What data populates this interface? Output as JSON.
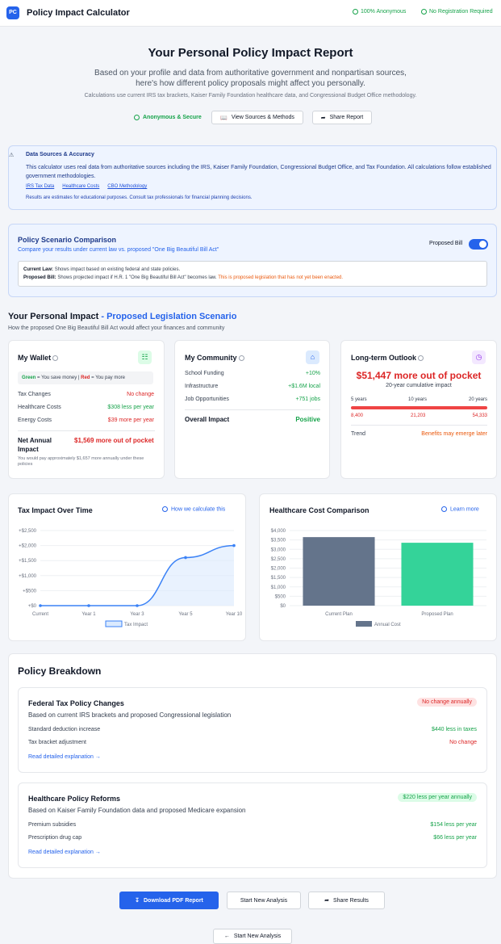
{
  "app": {
    "logo": "PC",
    "title": "Policy Impact Calculator",
    "badge_anonymous": "100% Anonymous",
    "badge_noreg": "No Registration Required"
  },
  "hero": {
    "title": "Your Personal Policy Impact Report",
    "subtitle": "Based on your profile and data from authoritative government and nonpartisan sources, here's how different policy proposals might affect you personally.",
    "note": "Calculations use current IRS tax brackets, Kaiser Family Foundation healthcare data, and Congressional Budget Office methodology.",
    "anon_label": "Anonymous & Secure",
    "sources_btn": "View Sources & Methods",
    "share_btn": "Share Report"
  },
  "sources": {
    "title": "Data Sources & Accuracy",
    "text": "This calculator uses real data from authoritative sources including the IRS, Kaiser Family Foundation, Congressional Budget Office, and Tax Foundation. All calculations follow established government methodologies.",
    "links": [
      "IRS Tax Data",
      "Healthcare Costs",
      "CBO Methodology"
    ],
    "note": "Results are estimates for educational purposes. Consult tax professionals for financial planning decisions."
  },
  "scenario": {
    "title": "Policy Scenario Comparison",
    "subtitle": "Compare your results under current law vs. proposed \"One Big Beautiful Bill Act\"",
    "toggle_label": "Proposed Bill",
    "toggle_on": true,
    "current_label": "Current Law:",
    "current_text": "Shows impact based on existing federal and state policies.",
    "proposed_label": "Proposed Bill:",
    "proposed_text": "Shows projected impact if H.R. 1 \"One Big Beautiful Bill Act\" becomes law.",
    "proposed_warning": "This is proposed legislation that has not yet been enacted."
  },
  "impact": {
    "title": "Your Personal Impact",
    "title_accent": "- Proposed Legislation Scenario",
    "subtitle": "How the proposed One Big Beautiful Bill Act would affect your finances and community"
  },
  "wallet": {
    "title": "My Wallet",
    "legend_green": "Green",
    "legend_green_text": "= You save money |",
    "legend_red": "Red",
    "legend_red_text": "= You pay more",
    "rows": [
      {
        "label": "Tax Changes",
        "value": "No change"
      },
      {
        "label": "Healthcare Costs",
        "value": "$308 less per year"
      },
      {
        "label": "Energy Costs",
        "value": "$39 more per year"
      }
    ],
    "net_label": "Net Annual Impact",
    "net_value": "$1,569 more out of pocket",
    "net_note": "You would pay approximately $1,657 more annually under these policies"
  },
  "community": {
    "title": "My Community",
    "rows": [
      {
        "label": "School Funding",
        "value": "+10%"
      },
      {
        "label": "Infrastructure",
        "value": "+$1.6M local"
      },
      {
        "label": "Job Opportunities",
        "value": "+751 jobs"
      }
    ],
    "overall_label": "Overall Impact",
    "overall_value": "Positive"
  },
  "outlook": {
    "title": "Long-term Outlook",
    "amount": "$51,447 more out of pocket",
    "amount_sub": "20-year cumulative impact",
    "periods": [
      "5 years",
      "10 years",
      "20 years"
    ],
    "values": [
      "8,400",
      "21,203",
      "54,333"
    ],
    "trend_label": "Trend",
    "trend_value": "Benefits may emerge later"
  },
  "tax_chart": {
    "title": "Tax Impact Over Time",
    "link": "How we calculate this"
  },
  "health_chart": {
    "title": "Healthcare Cost Comparison",
    "link": "Learn more"
  },
  "chart_data": [
    {
      "type": "line",
      "title": "Tax Impact Over Time",
      "categories": [
        "Current",
        "Year 1",
        "Year 3",
        "Year 5",
        "Year 10"
      ],
      "series": [
        {
          "name": "Tax Impact",
          "values": [
            0,
            0,
            0,
            1600,
            2000
          ]
        }
      ],
      "ylim": [
        0,
        2500
      ],
      "yticks": [
        "+$0",
        "+$500",
        "+$1,000",
        "+$1,500",
        "+$2,000",
        "+$2,500"
      ],
      "legend": "bottom",
      "color": "#3b82f6"
    },
    {
      "type": "bar",
      "title": "Healthcare Cost Comparison",
      "categories": [
        "Current Plan",
        "Proposed Plan"
      ],
      "series": [
        {
          "name": "Annual Cost",
          "values": [
            3650,
            3350
          ]
        }
      ],
      "ylim": [
        0,
        4000
      ],
      "yticks": [
        "$0",
        "$500",
        "$1,000",
        "$1,500",
        "$2,000",
        "$2,500",
        "$3,000",
        "$3,500",
        "$4,000"
      ],
      "colors": [
        "#64748b",
        "#34d399"
      ],
      "legend": "bottom"
    }
  ],
  "breakdown": {
    "title": "Policy Breakdown",
    "policies": [
      {
        "title": "Federal Tax Policy Changes",
        "pill": "No change annually",
        "subtitle": "Based on current IRS brackets and proposed Congressional legislation",
        "rows": [
          {
            "label": "Standard deduction increase",
            "value": "$440 less in taxes"
          },
          {
            "label": "Tax bracket adjustment",
            "value": "No change"
          }
        ],
        "link": "Read detailed explanation →"
      },
      {
        "title": "Healthcare Policy Reforms",
        "pill": "$220 less per year annually",
        "subtitle": "Based on Kaiser Family Foundation data and proposed Medicare expansion",
        "rows": [
          {
            "label": "Premium subsidies",
            "value": "$154 less per year"
          },
          {
            "label": "Prescription drug cap",
            "value": "$66 less per year"
          }
        ],
        "link": "Read detailed explanation →"
      }
    ]
  },
  "actions": {
    "download": "Download PDF Report",
    "new_analysis": "Start New Analysis",
    "share": "Share Results",
    "back": "Start New Analysis"
  },
  "colors": {
    "primary": "#2563eb",
    "green": "#16a34a",
    "red": "#dc2626",
    "orange": "#ea580c"
  }
}
